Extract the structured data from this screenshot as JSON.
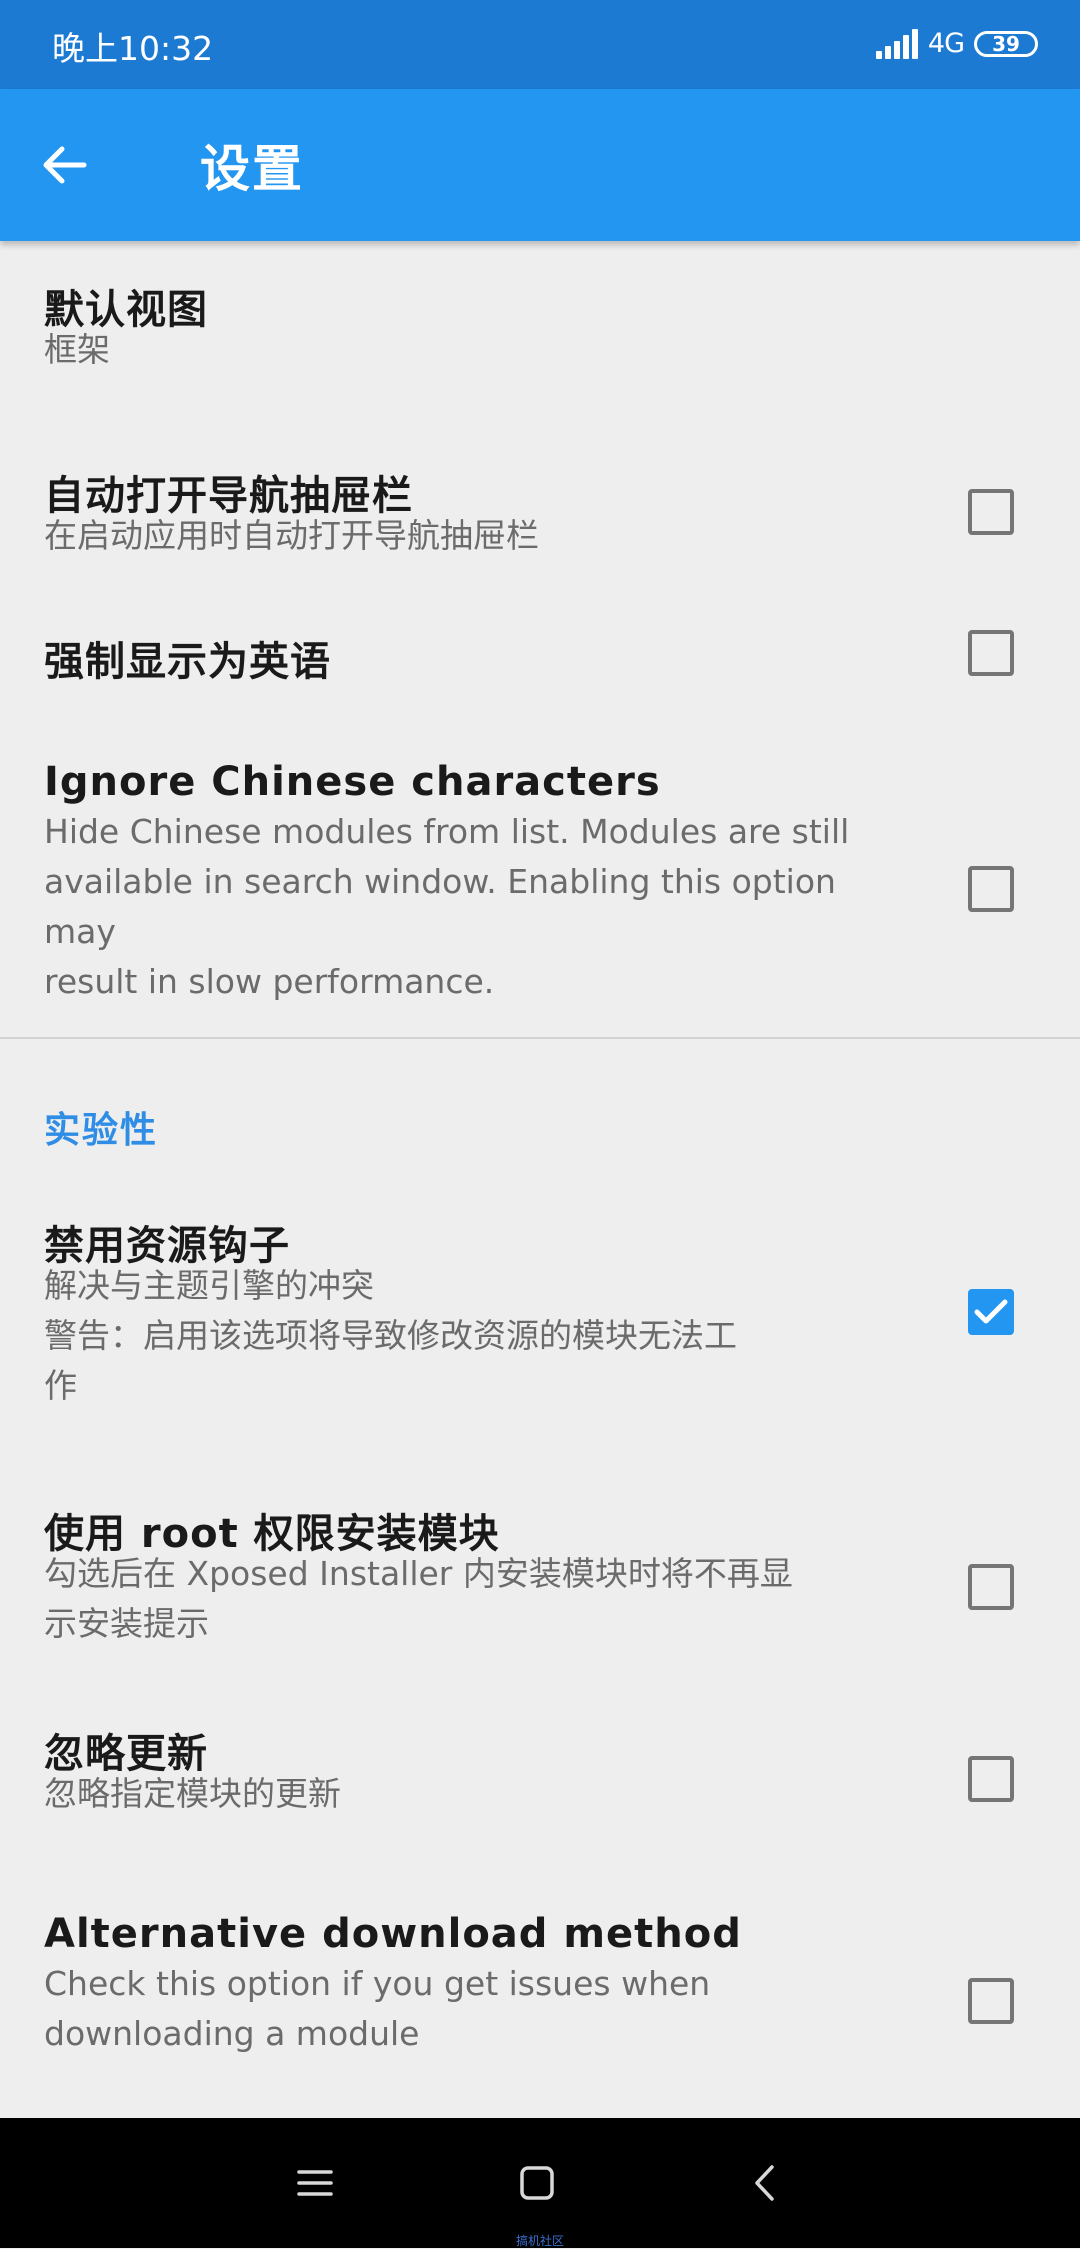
{
  "status_bar": {
    "time": "晚上10:32",
    "network": "4G",
    "battery": "39"
  },
  "app_bar": {
    "title": "设置",
    "back_icon": "arrow-left-icon"
  },
  "prefs": [
    {
      "title": "默认视图",
      "summary": "框架",
      "checkbox": null
    },
    {
      "title": "自动打开导航抽屉栏",
      "summary": "在启动应用时自动打开导航抽屉栏",
      "checkbox": false
    },
    {
      "title": "强制显示为英语",
      "summary": "",
      "checkbox": false
    },
    {
      "title": "Ignore Chinese characters",
      "summary": "Hide Chinese modules from list. Modules are still\navailable in search window. Enabling this option may\nresult in slow performance.",
      "checkbox": false
    }
  ],
  "category": {
    "title": "实验性"
  },
  "experimental_prefs": [
    {
      "title": "禁用资源钩子",
      "summary": "解决与主题引擎的冲突\n警告：启用该选项将导致修改资源的模块无法工\n作",
      "checkbox": true
    },
    {
      "title": "使用 root 权限安装模块",
      "summary": "勾选后在 Xposed Installer 内安装模块时将不再显\n示安装提示",
      "checkbox": false
    },
    {
      "title": "忽略更新",
      "summary": "忽略指定模块的更新",
      "checkbox": false
    },
    {
      "title": "Alternative download method",
      "summary": "Check this option if you get issues when\ndownloading a module",
      "checkbox": false
    }
  ],
  "nav_bar": {
    "menu_icon": "menu-icon",
    "home_icon": "home-square-icon",
    "back_icon": "chevron-left-icon"
  },
  "watermark": "搞机社区",
  "colors": {
    "status_bar": "#1d7ad3",
    "app_bar": "#2396f1",
    "accent": "#2f8de6",
    "background": "#eeeeee"
  }
}
